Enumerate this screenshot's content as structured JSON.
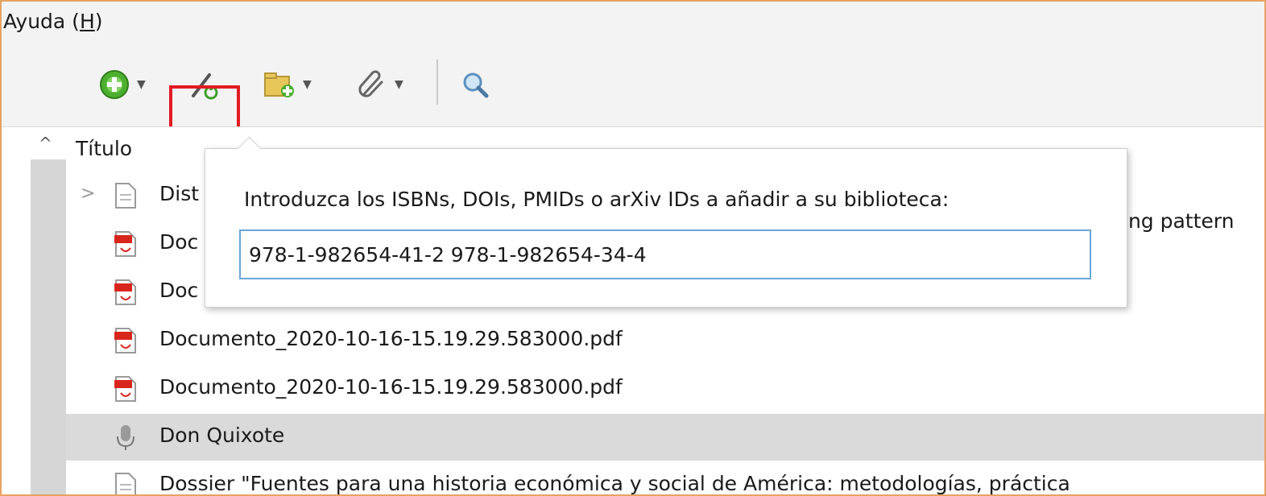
{
  "menu": {
    "help_label": "Ayuda (",
    "help_key": "H",
    "help_close": ")"
  },
  "toolbar": {
    "items": [
      {
        "icon": "add-circle-icon",
        "has_dropdown": true
      },
      {
        "icon": "magic-wand-icon",
        "has_dropdown": false,
        "highlighted": true
      },
      {
        "icon": "new-collection-icon",
        "has_dropdown": true
      },
      {
        "icon": "paperclip-icon",
        "has_dropdown": true
      },
      {
        "icon": "search-icon",
        "has_dropdown": false
      }
    ]
  },
  "list": {
    "column_title": "Título",
    "rows": [
      {
        "label": "Dist",
        "trailing": "ing pattern",
        "icon": "document-icon",
        "expandable": true
      },
      {
        "label": "Doc",
        "icon": "pdf-icon"
      },
      {
        "label": "Doc",
        "icon": "pdf-icon"
      },
      {
        "label": "Documento_2020-10-16-15.19.29.583000.pdf",
        "icon": "pdf-icon"
      },
      {
        "label": "Documento_2020-10-16-15.19.29.583000.pdf",
        "icon": "pdf-icon"
      },
      {
        "label": "Don Quixote",
        "icon": "audio-icon",
        "selected": true
      },
      {
        "label": "Dossier \"Fuentes para una historia económica y social de América: metodologías, práctica",
        "icon": "document-icon"
      }
    ]
  },
  "popup": {
    "prompt": "Introduzca los ISBNs, DOIs, PMIDs o arXiv IDs a añadir a su biblioteca:",
    "input_value": "978-1-982654-41-2 978-1-982654-34-4"
  },
  "colors": {
    "highlight_border": "#e21b22",
    "input_border": "#6aa7d8",
    "frame_border": "#e8a262"
  }
}
